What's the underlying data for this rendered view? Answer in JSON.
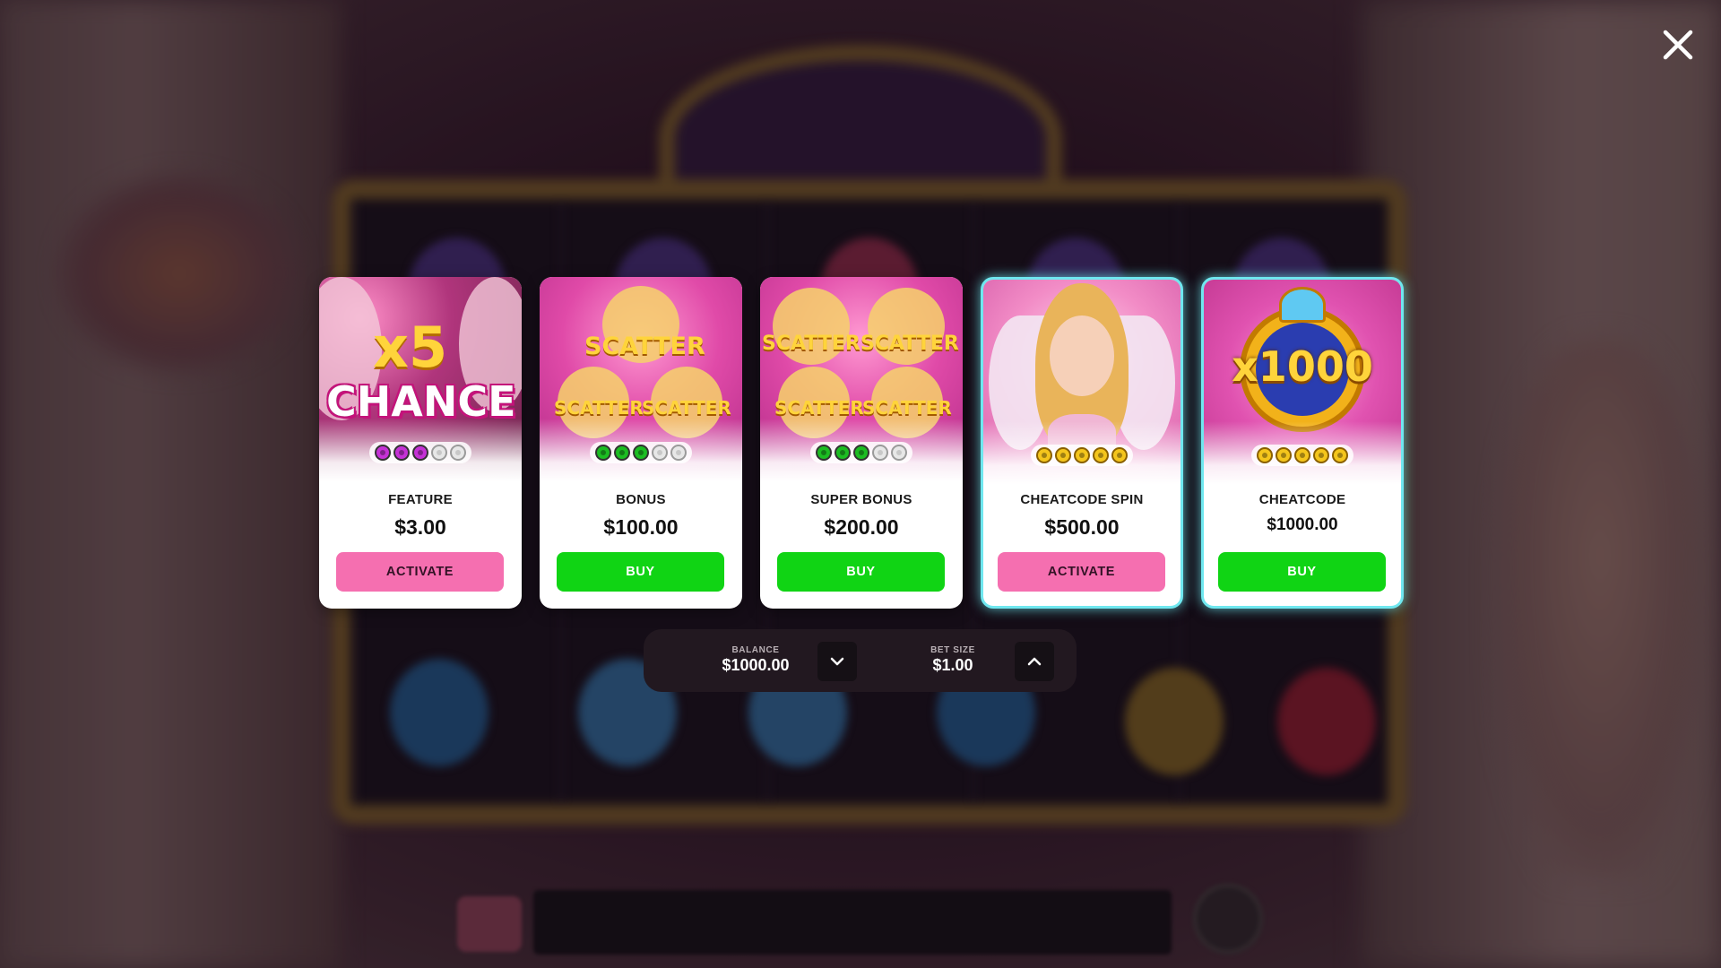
{
  "close": {
    "icon": "close-icon"
  },
  "cards": [
    {
      "title": "FEATURE",
      "price": "$3.00",
      "button": "ACTIVATE",
      "button_style": "pink",
      "art_text": [
        "x5",
        "CHANCE"
      ],
      "dots": {
        "filled": 3,
        "total": 5,
        "color": "#c532d6"
      }
    },
    {
      "title": "BONUS",
      "price": "$100.00",
      "button": "BUY",
      "button_style": "green",
      "art_text": [
        "SCATTER",
        "SCATTER",
        "SCATTER"
      ],
      "dots": {
        "filled": 3,
        "total": 5,
        "color": "#1cbd22"
      }
    },
    {
      "title": "SUPER BONUS",
      "price": "$200.00",
      "button": "BUY",
      "button_style": "green",
      "art_text": [
        "SCATTER",
        "SCATTER",
        "SCATTER",
        "SCATTER"
      ],
      "dots": {
        "filled": 3,
        "total": 5,
        "color": "#1cbd22"
      }
    },
    {
      "title": "CHEATCODE SPIN",
      "price": "$500.00",
      "button": "ACTIVATE",
      "button_style": "pink",
      "art_text": [],
      "dots": {
        "filled": 5,
        "total": 5,
        "color": "#f4c51c"
      }
    },
    {
      "title": "CHEATCODE",
      "price": "$1000.00",
      "button": "BUY",
      "button_style": "green",
      "art_text": [
        "x1000"
      ],
      "dots": {
        "filled": 5,
        "total": 5,
        "color": "#f4c51c"
      }
    }
  ],
  "bet_panel": {
    "balance_label": "BALANCE",
    "balance_value": "$1000.00",
    "bet_label": "BET SIZE",
    "bet_value": "$1.00",
    "decrease_icon": "chevron-down-icon",
    "increase_icon": "chevron-up-icon"
  },
  "colors": {
    "pink_button": "#f56fb0",
    "green_button": "#10d414",
    "glow_border": "#6fe7ef"
  }
}
